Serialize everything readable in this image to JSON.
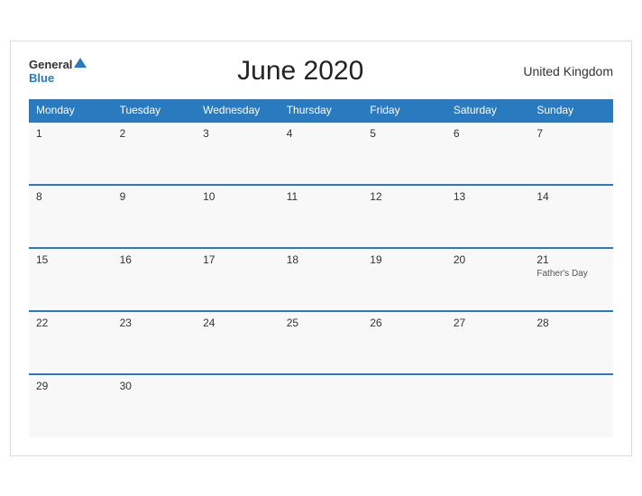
{
  "header": {
    "logo_general": "General",
    "logo_blue": "Blue",
    "title": "June 2020",
    "region": "United Kingdom"
  },
  "weekdays": [
    "Monday",
    "Tuesday",
    "Wednesday",
    "Thursday",
    "Friday",
    "Saturday",
    "Sunday"
  ],
  "weeks": [
    [
      {
        "date": "1",
        "event": ""
      },
      {
        "date": "2",
        "event": ""
      },
      {
        "date": "3",
        "event": ""
      },
      {
        "date": "4",
        "event": ""
      },
      {
        "date": "5",
        "event": ""
      },
      {
        "date": "6",
        "event": ""
      },
      {
        "date": "7",
        "event": ""
      }
    ],
    [
      {
        "date": "8",
        "event": ""
      },
      {
        "date": "9",
        "event": ""
      },
      {
        "date": "10",
        "event": ""
      },
      {
        "date": "11",
        "event": ""
      },
      {
        "date": "12",
        "event": ""
      },
      {
        "date": "13",
        "event": ""
      },
      {
        "date": "14",
        "event": ""
      }
    ],
    [
      {
        "date": "15",
        "event": ""
      },
      {
        "date": "16",
        "event": ""
      },
      {
        "date": "17",
        "event": ""
      },
      {
        "date": "18",
        "event": ""
      },
      {
        "date": "19",
        "event": ""
      },
      {
        "date": "20",
        "event": ""
      },
      {
        "date": "21",
        "event": "Father's Day"
      }
    ],
    [
      {
        "date": "22",
        "event": ""
      },
      {
        "date": "23",
        "event": ""
      },
      {
        "date": "24",
        "event": ""
      },
      {
        "date": "25",
        "event": ""
      },
      {
        "date": "26",
        "event": ""
      },
      {
        "date": "27",
        "event": ""
      },
      {
        "date": "28",
        "event": ""
      }
    ],
    [
      {
        "date": "29",
        "event": ""
      },
      {
        "date": "30",
        "event": ""
      },
      {
        "date": "",
        "event": ""
      },
      {
        "date": "",
        "event": ""
      },
      {
        "date": "",
        "event": ""
      },
      {
        "date": "",
        "event": ""
      },
      {
        "date": "",
        "event": ""
      }
    ]
  ]
}
